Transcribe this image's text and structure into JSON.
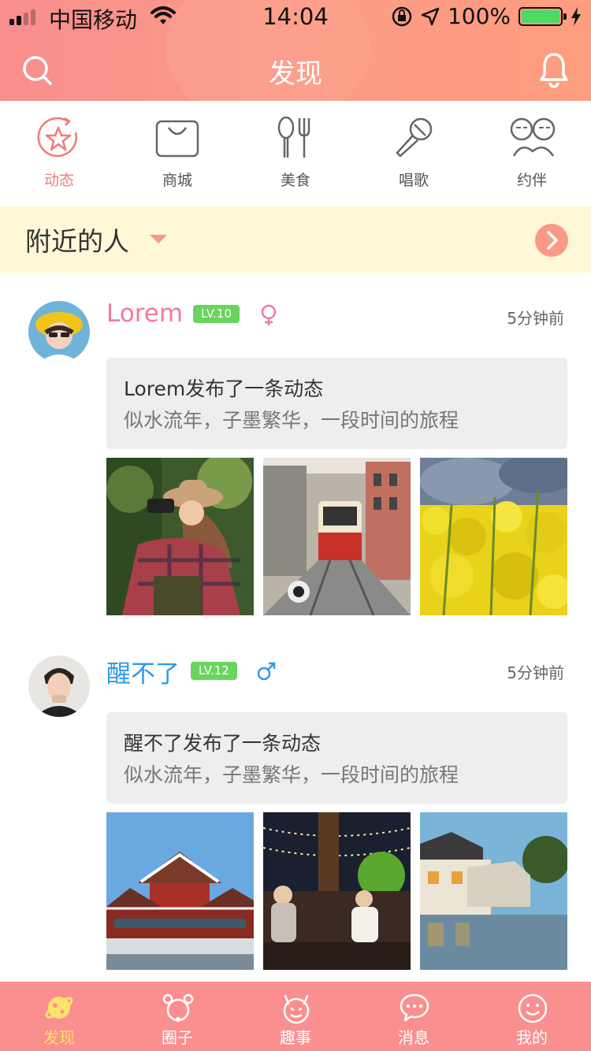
{
  "status_bar": {
    "carrier": "中国移动",
    "time": "14:04",
    "battery": "100%"
  },
  "nav": {
    "title": "发现",
    "search_icon": "search-icon",
    "bell_icon": "bell-icon"
  },
  "categories": [
    {
      "label": "动态",
      "icon": "star-refresh-icon",
      "active": true
    },
    {
      "label": "商城",
      "icon": "shopping-bag-icon",
      "active": false
    },
    {
      "label": "美食",
      "icon": "spoon-fork-icon",
      "active": false
    },
    {
      "label": "唱歌",
      "icon": "microphone-icon",
      "active": false
    },
    {
      "label": "约伴",
      "icon": "two-faces-icon",
      "active": false
    }
  ],
  "nearby": {
    "title": "附近的人"
  },
  "posts": [
    {
      "username": "Lorem",
      "level": "LV.10",
      "gender": "female",
      "time": "5分钟前",
      "line1": "Lorem发布了一条动态",
      "line2": "似水流年，子墨繁华，一段时间的旅程"
    },
    {
      "username": "醒不了",
      "level": "LV.12",
      "gender": "male",
      "time": "5分钟前",
      "line1": "醒不了发布了一条动态",
      "line2": "似水流年，子墨繁华，一段时间的旅程"
    }
  ],
  "tabs": [
    {
      "label": "发现",
      "icon": "planet-icon",
      "active": true
    },
    {
      "label": "圈子",
      "icon": "circle-group-icon",
      "active": false
    },
    {
      "label": "趣事",
      "icon": "devil-face-icon",
      "active": false
    },
    {
      "label": "消息",
      "icon": "chat-bubble-icon",
      "active": false
    },
    {
      "label": "我的",
      "icon": "smile-face-icon",
      "active": false
    }
  ],
  "colors": {
    "header": "#fa958a",
    "accent": "#f27a7a",
    "level_badge": "#6ad45c",
    "female": "#f27a9a",
    "male": "#2f9ae6",
    "nearby_bg": "#fff8d8",
    "tab_active": "#ffe26b"
  }
}
